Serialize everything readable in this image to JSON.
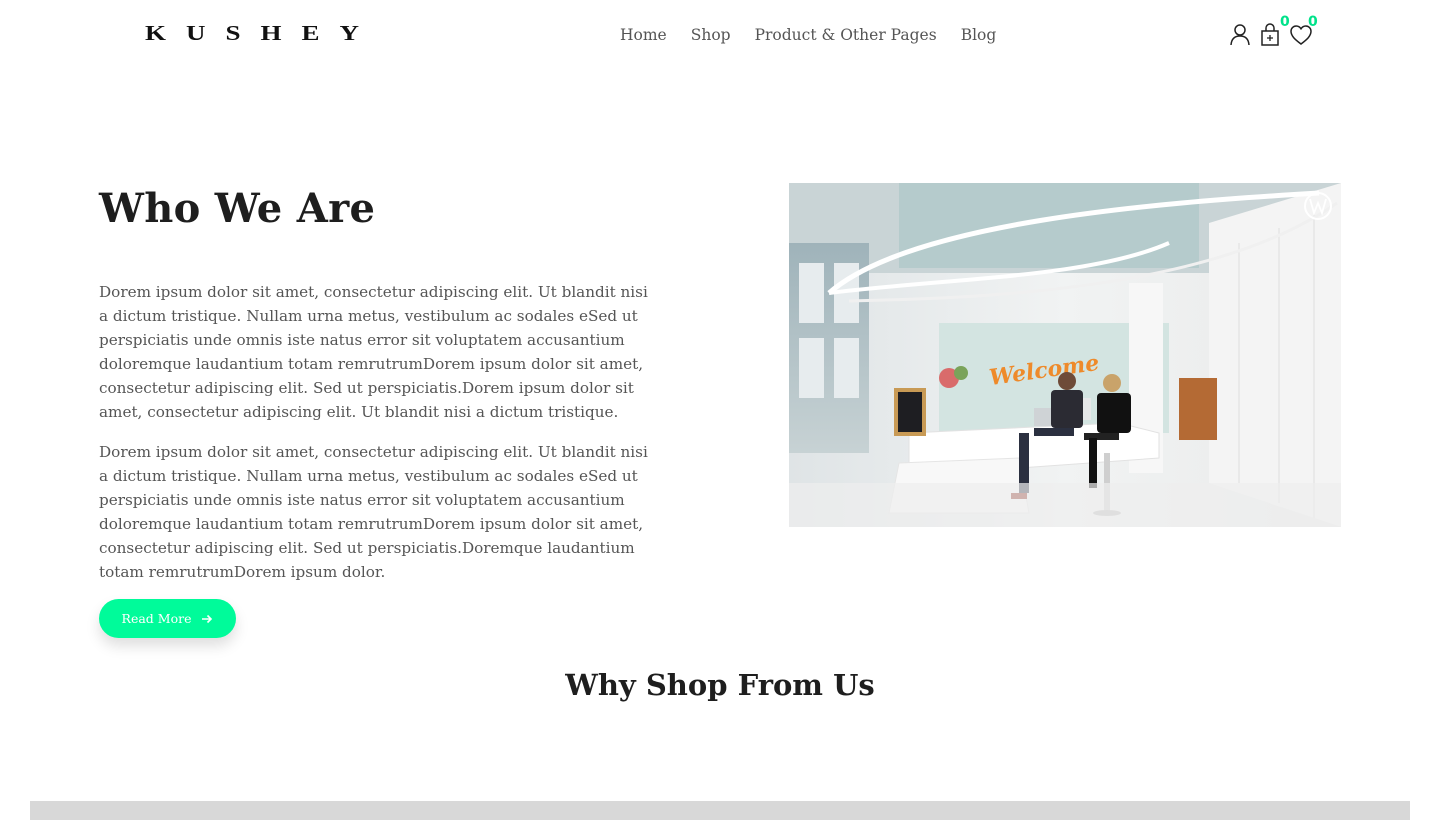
{
  "header": {
    "logo_text": "KUSHEY",
    "nav": [
      {
        "label": "Home"
      },
      {
        "label": "Shop"
      },
      {
        "label": "Product & Other Pages"
      },
      {
        "label": "Blog"
      }
    ],
    "icons": {
      "account": "user-icon",
      "cart": "shopping-bag-icon",
      "wishlist": "heart-icon"
    },
    "cart_count": "0",
    "wishlist_count": "0",
    "badge_color": "#00e28a"
  },
  "about": {
    "title": "Who We Are",
    "paragraph_1": "Dorem ipsum dolor sit amet, consectetur adipiscing elit. Ut blandit nisi a dictum tristique. Nullam urna metus, vestibulum ac sodales eSed ut perspiciatis unde omnis iste natus error sit voluptatem accusantium doloremque laudantium totam remrutrumDorem ipsum dolor sit amet, consectetur adipiscing elit. Sed ut perspiciatis.Dorem ipsum dolor sit amet, consectetur adipiscing elit. Ut blandit nisi a dictum tristique.",
    "paragraph_2": "Dorem ipsum dolor sit amet, consectetur adipiscing elit. Ut blandit nisi a dictum tristique. Nullam urna metus, vestibulum ac sodales eSed ut perspiciatis unde omnis iste natus error sit voluptatem accusantium doloremque laudantium totam remrutrumDorem ipsum dolor sit amet, consectetur adipiscing elit. Sed ut perspiciatis.Doremque laudantium totam remrutrumDorem ipsum dolor.",
    "button_label": "Read More",
    "button_icon": "arrow-right-icon",
    "button_color": "#00fb9a",
    "image_sign": "Welcome"
  },
  "why_section": {
    "title": "Why Shop From Us"
  }
}
